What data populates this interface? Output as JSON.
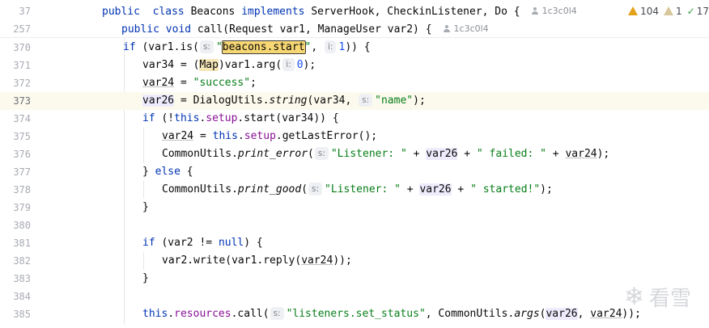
{
  "sticky": [
    {
      "num": "37",
      "tokens": [
        [
          "kw",
          "public"
        ],
        [
          "",
          "  "
        ],
        [
          "kw",
          "class"
        ],
        [
          "",
          " Beacons "
        ],
        [
          "kw",
          "implements"
        ],
        [
          "",
          " ServerHook, CheckinListener, Do {"
        ]
      ],
      "author": "1c3c0l4"
    },
    {
      "num": "257",
      "tokens": [
        [
          "kw",
          "public"
        ],
        [
          "",
          " "
        ],
        [
          "kw",
          "void"
        ],
        [
          "",
          " call(Request var1, ManageUser var2) {"
        ]
      ],
      "author": "1c3c0l4"
    }
  ],
  "inspections": {
    "warnings": "104",
    "weak_warnings": "1",
    "typos": "17"
  },
  "lines": [
    {
      "num": "370",
      "tokens": [
        [
          "kw",
          "if"
        ],
        [
          "",
          " (var1.is("
        ],
        [
          "hint",
          "s:"
        ],
        [
          "str",
          "\""
        ],
        [
          "sel",
          "beacons.start"
        ],
        [
          "str",
          "\""
        ],
        [
          "",
          ", "
        ],
        [
          "hint",
          "i:"
        ],
        [
          "num",
          "1"
        ],
        [
          "",
          "))"
        ],
        [
          "",
          " {"
        ]
      ]
    },
    {
      "num": "371",
      "tokens": [
        [
          "",
          "var34 = ("
        ],
        [
          "hl-type",
          "Map"
        ],
        [
          "",
          ")var1.arg("
        ],
        [
          "hint",
          "i:"
        ],
        [
          "num",
          "0"
        ],
        [
          "",
          ");"
        ]
      ]
    },
    {
      "num": "372",
      "tokens": [
        [
          "ul",
          "var24"
        ],
        [
          "",
          " = "
        ],
        [
          "str",
          "\"success\""
        ],
        [
          "",
          ";"
        ]
      ]
    },
    {
      "num": "373",
      "tokens": [
        [
          "hl-var",
          "var26"
        ],
        [
          "",
          " = DialogUtils."
        ],
        [
          "it",
          "string"
        ],
        [
          "",
          "(var34, "
        ],
        [
          "hint",
          "s:"
        ],
        [
          "str",
          "\"name\""
        ],
        [
          "",
          ");"
        ]
      ]
    },
    {
      "num": "374",
      "tokens": [
        [
          "kw",
          "if"
        ],
        [
          "",
          " (!"
        ],
        [
          "kw",
          "this"
        ],
        [
          "",
          "."
        ],
        [
          "fld",
          "setup"
        ],
        [
          "",
          ".start(var34)) {"
        ]
      ]
    },
    {
      "num": "375",
      "tokens": [
        [
          "ul",
          "var24"
        ],
        [
          "",
          " = "
        ],
        [
          "kw",
          "this"
        ],
        [
          "",
          "."
        ],
        [
          "fld",
          "setup"
        ],
        [
          "",
          ".getLastError();"
        ]
      ]
    },
    {
      "num": "376",
      "tokens": [
        [
          "",
          "CommonUtils."
        ],
        [
          "it",
          "print_error"
        ],
        [
          "",
          "("
        ],
        [
          "hint",
          "s:"
        ],
        [
          "str",
          "\"Listener: \""
        ],
        [
          "",
          " + "
        ],
        [
          "hl-var",
          "var26"
        ],
        [
          "",
          " + "
        ],
        [
          "str",
          "\" failed: \""
        ],
        [
          "",
          " + "
        ],
        [
          "ul",
          "var24"
        ],
        [
          "",
          ");"
        ]
      ]
    },
    {
      "num": "377",
      "tokens": [
        [
          "",
          "} "
        ],
        [
          "kw",
          "else"
        ],
        [
          "",
          " {"
        ]
      ]
    },
    {
      "num": "378",
      "tokens": [
        [
          "",
          "CommonUtils."
        ],
        [
          "it",
          "print_good"
        ],
        [
          "",
          "("
        ],
        [
          "hint",
          "s:"
        ],
        [
          "str",
          "\"Listener: \""
        ],
        [
          "",
          " + "
        ],
        [
          "hl-var",
          "var26"
        ],
        [
          "",
          " + "
        ],
        [
          "str",
          "\" started!\""
        ],
        [
          "",
          ");"
        ]
      ]
    },
    {
      "num": "379",
      "tokens": [
        [
          "",
          "}"
        ]
      ]
    },
    {
      "num": "380",
      "tokens": []
    },
    {
      "num": "381",
      "tokens": [
        [
          "kw",
          "if"
        ],
        [
          "",
          " (var2 != "
        ],
        [
          "kw",
          "null"
        ],
        [
          "",
          ") {"
        ]
      ]
    },
    {
      "num": "382",
      "tokens": [
        [
          "",
          "var2.write(var1.reply("
        ],
        [
          "ul",
          "var24"
        ],
        [
          "",
          "));"
        ]
      ]
    },
    {
      "num": "383",
      "tokens": [
        [
          "",
          "}"
        ]
      ]
    },
    {
      "num": "384",
      "tokens": []
    },
    {
      "num": "385",
      "tokens": [
        [
          "kw",
          "this"
        ],
        [
          "",
          "."
        ],
        [
          "fld",
          "resources"
        ],
        [
          "",
          ".call("
        ],
        [
          "hint",
          "s:"
        ],
        [
          "str",
          "\"listeners.set_status\""
        ],
        [
          "",
          ", CommonUtils."
        ],
        [
          "it",
          "args"
        ],
        [
          "",
          "("
        ],
        [
          "hl-var",
          "var26"
        ],
        [
          "",
          ", "
        ],
        [
          "ul",
          "var24"
        ],
        [
          "",
          "));"
        ]
      ]
    }
  ],
  "watermark": {
    "icon": "❄",
    "text": "看雪"
  }
}
